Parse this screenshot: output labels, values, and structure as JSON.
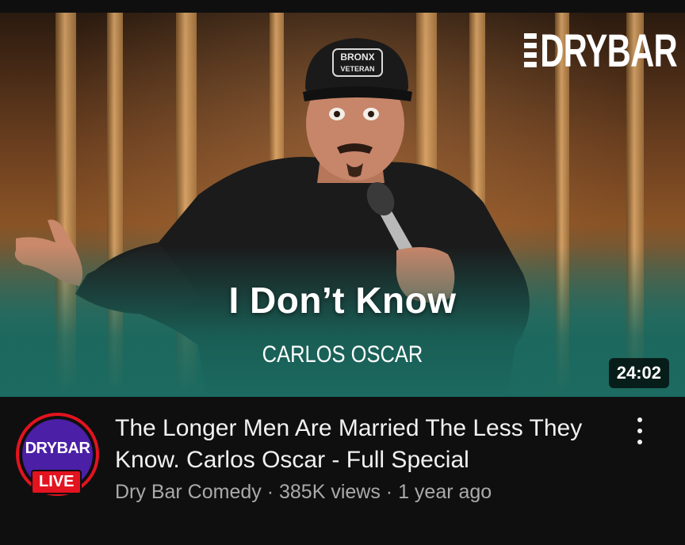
{
  "thumbnail": {
    "brand": "DRYBAR",
    "cap_text": "BRONX VETERAN",
    "title": "I Don’t Know",
    "subtitle": "CARLOS OSCAR",
    "duration": "24:02"
  },
  "channel": {
    "avatar_text": "DRYBAR",
    "live_label": "LIVE"
  },
  "video": {
    "title": "The Longer Men Are Married The Less They Know. Carlos Oscar - Full Special",
    "channel_name": "Dry Bar Comedy",
    "views": "385K views",
    "age": "1 year ago",
    "separator": " · "
  },
  "colors": {
    "background": "#0f0f0f",
    "live_red": "#e3131f",
    "avatar_purple": "#4b1fa6",
    "secondary_text": "#aaaaaa"
  },
  "icons": {
    "menu": "more-vert-icon"
  }
}
